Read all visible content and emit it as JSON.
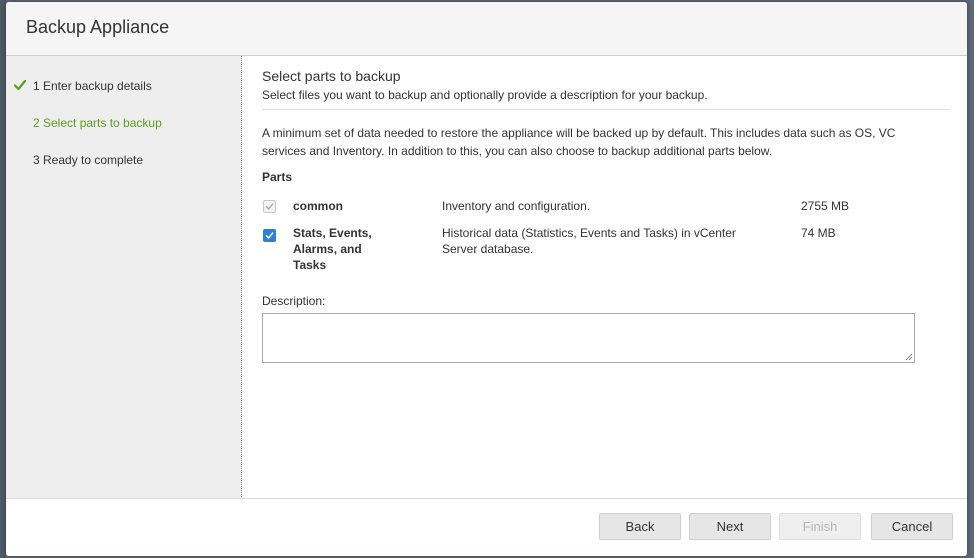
{
  "dialog": {
    "title": "Backup Appliance"
  },
  "steps": [
    {
      "label": "1 Enter backup details",
      "state": "done"
    },
    {
      "label": "2 Select parts to backup",
      "state": "active"
    },
    {
      "label": "3 Ready to complete",
      "state": "pending"
    }
  ],
  "section": {
    "title": "Select parts to backup",
    "subtitle": "Select files you want to backup and optionally provide a description for your backup.",
    "intro": "A minimum set of data needed to restore the appliance will be backed up by default. This includes data such as OS, VC services and Inventory. In addition to this, you can also choose to backup additional parts below.",
    "parts_label": "Parts"
  },
  "parts": [
    {
      "name": "common",
      "description": "Inventory and configuration.",
      "size": "2755 MB",
      "checked": true,
      "disabled": true
    },
    {
      "name": "Stats, Events, Alarms, and Tasks",
      "description": "Historical data (Statistics, Events and Tasks) in vCenter Server database.",
      "size": "74 MB",
      "checked": true,
      "disabled": false
    }
  ],
  "description": {
    "label": "Description:",
    "value": ""
  },
  "footer": {
    "back": "Back",
    "next": "Next",
    "finish": "Finish",
    "cancel": "Cancel"
  },
  "colors": {
    "accent_green": "#5a9e1d",
    "checkbox_blue": "#2f7fd8",
    "sidebar_bg": "#eeeeee"
  },
  "icons": {
    "step_done": "checkmark-icon",
    "checkbox": "checkbox-icon",
    "resize": "resize-grip-icon"
  }
}
